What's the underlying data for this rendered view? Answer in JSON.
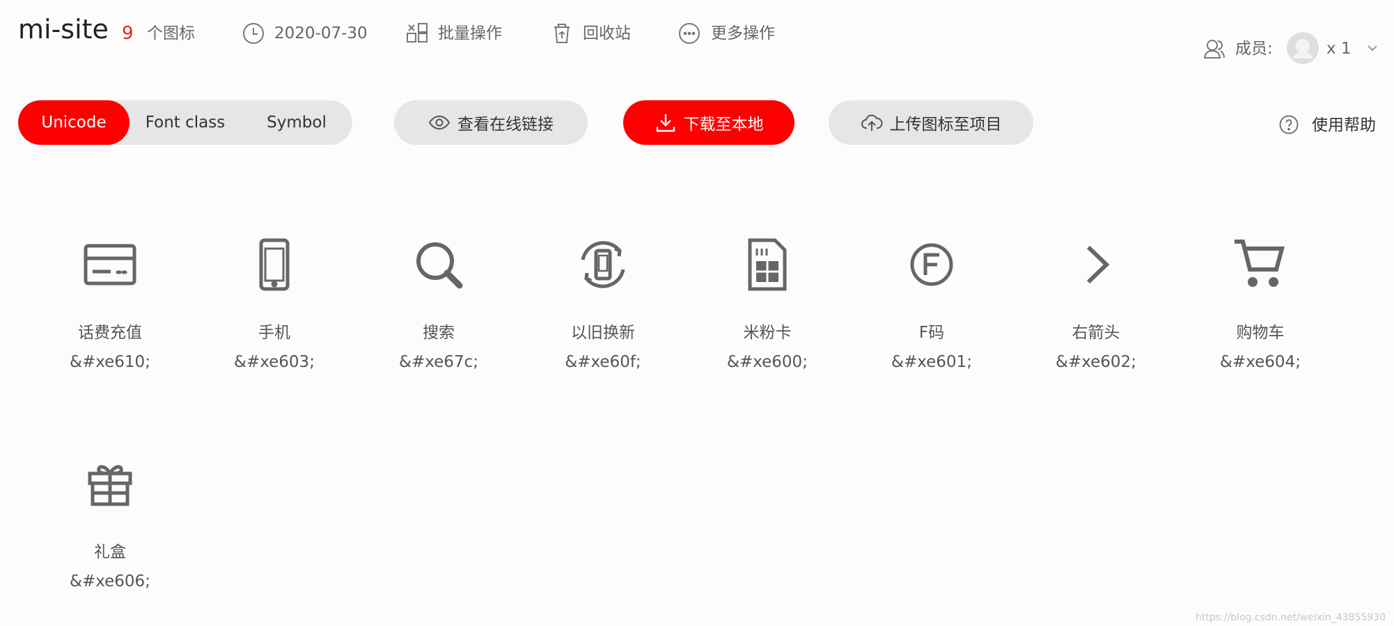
{
  "project": {
    "name": "mi-site",
    "icon_count": "9",
    "icon_count_label": "个图标",
    "date": "2020-07-30",
    "batch_label": "批量操作",
    "recycle_label": "回收站",
    "more_label": "更多操作"
  },
  "members": {
    "label": "成员:",
    "count": "x 1"
  },
  "tabs": [
    {
      "label": "Unicode",
      "active": true
    },
    {
      "label": "Font class",
      "active": false
    },
    {
      "label": "Symbol",
      "active": false
    }
  ],
  "actions": {
    "view_link": "查看在线链接",
    "download": "下载至本地",
    "upload": "上传图标至项目",
    "help": "使用帮助"
  },
  "icons": [
    {
      "name": "话费充值",
      "code": "&#xe610;",
      "icon": "card-icon"
    },
    {
      "name": "手机",
      "code": "&#xe603;",
      "icon": "phone-icon"
    },
    {
      "name": "搜索",
      "code": "&#xe67c;",
      "icon": "search-icon"
    },
    {
      "name": "以旧换新",
      "code": "&#xe60f;",
      "icon": "trade-in-icon"
    },
    {
      "name": "米粉卡",
      "code": "&#xe600;",
      "icon": "sim-card-icon"
    },
    {
      "name": "F码",
      "code": "&#xe601;",
      "icon": "f-code-icon"
    },
    {
      "name": "右箭头",
      "code": "&#xe602;",
      "icon": "right-arrow-icon"
    },
    {
      "name": "购物车",
      "code": "&#xe604;",
      "icon": "cart-icon"
    },
    {
      "name": "礼盒",
      "code": "&#xe606;",
      "icon": "gift-icon"
    }
  ],
  "watermark": "https://blog.csdn.net/weixin_43855930",
  "colors": {
    "accent": "#ff0000",
    "pill_gray": "#e6e6e6",
    "text": "#333333",
    "icon": "#666666"
  }
}
